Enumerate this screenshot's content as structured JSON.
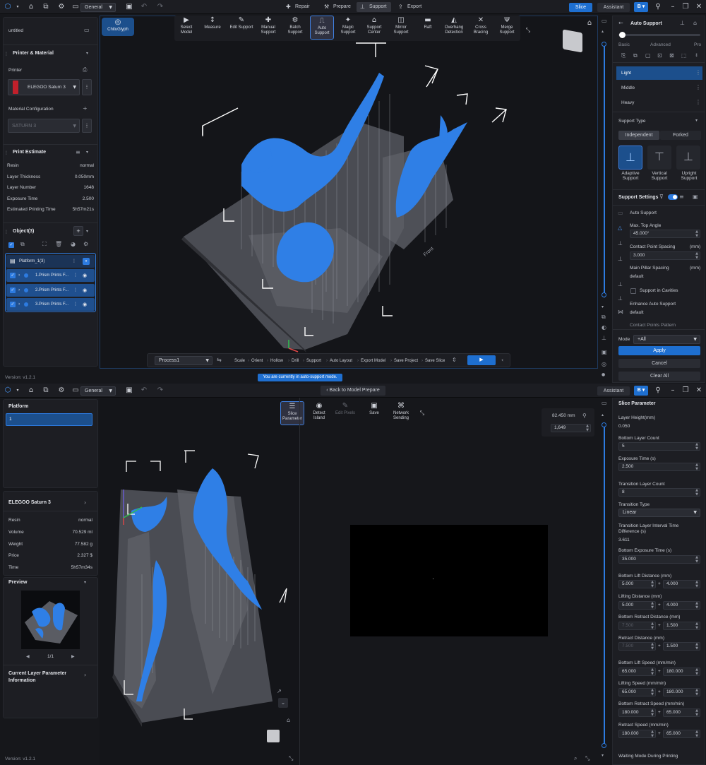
{
  "app": {
    "version": "Version: v1.2.1",
    "workspace": "General",
    "brand": "ChituGlyph"
  },
  "top": {
    "modes": [
      "Repair",
      "Prepare",
      "Support",
      "Export"
    ],
    "slice": "Slice",
    "assistant": "Assistant",
    "project": "untitled",
    "printer_material": "Printer & Material",
    "printer_label": "Printer",
    "printer": "ELEGOO Saturn 3",
    "material_config": "Material Configuration",
    "material": "SATURN 3",
    "print_estimate": "Print Estimate",
    "estimate": [
      {
        "k": "Resin",
        "v": "normal"
      },
      {
        "k": "Layer Thickness",
        "v": "0.050mm"
      },
      {
        "k": "Layer Number",
        "v": "1648"
      },
      {
        "k": "Exposure Time",
        "v": "2.500"
      },
      {
        "k": "Estimated Printing Time",
        "v": "5h57m21s"
      }
    ],
    "objects_title": "Object(3)",
    "platform": "Platform_1(3)",
    "objects": [
      "1.Prism Prints F...",
      "2.Prism Prints F...",
      "3.Prism Prints F..."
    ],
    "tools": [
      {
        "icon": "▶",
        "label": "Select Model"
      },
      {
        "icon": "↕",
        "label": "Measure"
      },
      {
        "icon": "✎",
        "label": "Edit Support"
      },
      {
        "icon": "✚",
        "label": "Manual Support"
      },
      {
        "icon": "⚙",
        "label": "Batch Support"
      },
      {
        "icon": "⎍",
        "label": "Auto Support"
      },
      {
        "icon": "✦",
        "label": "Magic Support"
      },
      {
        "icon": "⌂",
        "label": "Support Center"
      },
      {
        "icon": "◫",
        "label": "Mirror Support"
      },
      {
        "icon": "▬",
        "label": "Raft"
      },
      {
        "icon": "◭",
        "label": "Overhang Detection"
      },
      {
        "icon": "✕",
        "label": "Cross Bracing"
      },
      {
        "icon": "Ψ",
        "label": "Merge Support"
      }
    ],
    "process": "Process1",
    "pipeline": [
      "Scale",
      "Orient",
      "Hollow",
      "Drill",
      "Support",
      "Auto Layout",
      "Export Model",
      "Save Project",
      "Save Slice"
    ],
    "toast": "You are currently in auto-support mode.",
    "front_label": "Front",
    "auto_support": {
      "title": "Auto Support",
      "levels": [
        "Basic",
        "Advanced",
        "Pro"
      ],
      "density": [
        "Light",
        "Middle",
        "Heavy"
      ],
      "support_type": "Support Type",
      "type_tabs": [
        "Independent",
        "Forked"
      ],
      "shapes": [
        "Adaptive Support",
        "Vertical Support",
        "Upright Support"
      ],
      "settings": "Support Settings",
      "auto_support_item": "Auto Support",
      "max_top_angle": "Max. Top Angle",
      "max_top_angle_val": "45.000°",
      "contact_spacing": "Contact Point Spacing",
      "contact_spacing_unit": "(mm)",
      "contact_spacing_val": "3.000",
      "main_pillar": "Main Pillar Spacing",
      "main_pillar_unit": "(mm)",
      "main_pillar_val": "default",
      "support_cavities": "Support in Cavities",
      "enhance": "Enhance Auto Support",
      "enhance_val": "default",
      "contact_pattern": "Contact Points Pattern",
      "mode_label": "Mode",
      "mode_val": "+All",
      "apply": "Apply",
      "cancel": "Cancel",
      "clear_all": "Clear All"
    }
  },
  "bottom": {
    "back": "Back to Model Prepare",
    "platform_title": "Platform",
    "platform_item": "1",
    "printer": "ELEGOO Saturn 3",
    "stats": [
      {
        "k": "Resin",
        "v": "normal"
      },
      {
        "k": "Volume",
        "v": "70.529 ml"
      },
      {
        "k": "Weight",
        "v": "77.582 g"
      },
      {
        "k": "Price",
        "v": "2.327 $"
      },
      {
        "k": "Time",
        "v": "5h57m34s"
      }
    ],
    "preview": "Preview",
    "page": "1/1",
    "current_layer": "Current Layer Parameter Information",
    "tools": [
      {
        "icon": "☰",
        "label": "Slice Parameter"
      },
      {
        "icon": "◉",
        "label": "Detect Island"
      },
      {
        "icon": "✎",
        "label": "Edit Pixels"
      },
      {
        "icon": "▣",
        "label": "Save"
      },
      {
        "icon": "⌘",
        "label": "Network Sending"
      }
    ],
    "height_mm": "82.450 mm",
    "layer_num": "1,649",
    "slice_param": {
      "title": "Slice Parameter",
      "layer_height": "Layer Height(mm)",
      "layer_height_val": "0.050",
      "bottom_layer_count": "Bottom Layer Count",
      "bottom_layer_count_val": "5",
      "exposure": "Exposure Time (s)",
      "exposure_val": "2.500",
      "transition_count": "Transition Layer Count",
      "transition_count_val": "8",
      "transition_type": "Transition Type",
      "transition_type_val": "Linear",
      "transition_interval": "Transition Layer Interval Time Difference (s)",
      "transition_interval_val": "3.611",
      "bottom_exposure": "Bottom Exposure Time (s)",
      "bottom_exposure_val": "35.000",
      "bottom_lift": "Bottom Lift Distance (mm)",
      "bottom_lift_a": "5.000",
      "bottom_lift_b": "4.000",
      "lift": "Lifting Distance (mm)",
      "lift_a": "5.000",
      "lift_b": "4.000",
      "bottom_retract": "Bottom Retract Distance (mm)",
      "bottom_retract_a": "7.500",
      "bottom_retract_b": "1.500",
      "retract": "Retract Distance  (mm)",
      "retract_a": "7.500",
      "retract_b": "1.500",
      "bottom_lift_speed": "Bottom Lift Speed  (mm/min)",
      "bottom_lift_speed_a": "65.000",
      "bottom_lift_speed_b": "180.000",
      "lift_speed": "Lifting Speed  (mm/min)",
      "lift_speed_a": "65.000",
      "lift_speed_b": "180.000",
      "bottom_retract_speed": "Bottom Retract Speed  (mm/min)",
      "bottom_retract_speed_a": "180.000",
      "bottom_retract_speed_b": "65.000",
      "retract_speed": "Retract Speed  (mm/min)",
      "retract_speed_a": "180.000",
      "retract_speed_b": "65.000",
      "waiting_mode": "Waiting Mode During Printing",
      "plus": "+"
    }
  },
  "colors": {
    "accent": "#1e6fd0",
    "model": "#2f7fe6",
    "plate": "#5a5c63",
    "support": "#9a9da6"
  }
}
